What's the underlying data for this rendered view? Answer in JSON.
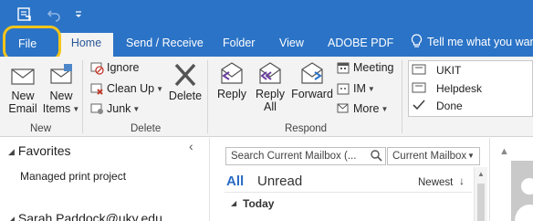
{
  "tabs": {
    "file": "File",
    "home": "Home",
    "send_receive": "Send / Receive",
    "folder": "Folder",
    "view": "View",
    "adobe_pdf": "ADOBE PDF",
    "tell_me": "Tell me what you wan"
  },
  "ribbon": {
    "new_group": {
      "label": "New",
      "new_email": [
        "New",
        "Email"
      ],
      "new_items": [
        "New",
        "Items"
      ]
    },
    "delete_group": {
      "label": "Delete",
      "ignore": "Ignore",
      "clean_up": "Clean Up",
      "junk": "Junk",
      "delete": "Delete"
    },
    "respond_group": {
      "label": "Respond",
      "reply": "Reply",
      "reply_all": [
        "Reply",
        "All"
      ],
      "forward": "Forward",
      "meeting": "Meeting",
      "im": "IM",
      "more": "More"
    },
    "quick_steps": [
      "UKIT",
      "Helpdesk",
      "Done"
    ]
  },
  "folder_pane": {
    "favorites": "Favorites",
    "favorite_item": "Managed print project",
    "account": "Sarah.Paddock@uky.edu"
  },
  "mail_list": {
    "search_placeholder": "Search Current Mailbox (...",
    "scope": "Current Mailbox",
    "filter_all": "All",
    "filter_unread": "Unread",
    "sort": "Newest",
    "group_today": "Today"
  },
  "colors": {
    "accent": "#2b73c6",
    "highlight": "#f5c518"
  }
}
